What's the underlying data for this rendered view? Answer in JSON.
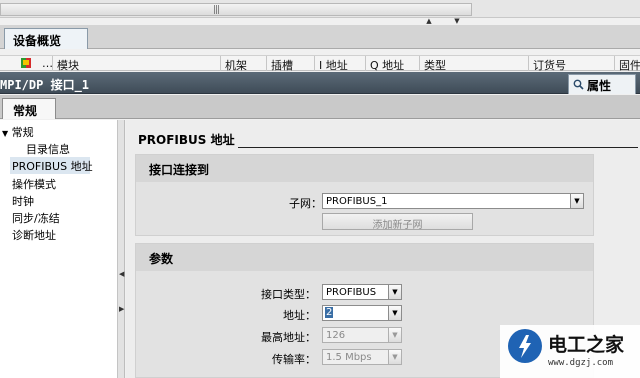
{
  "toolbar": {
    "scroll_grip": "|||"
  },
  "device_tabs": {
    "overview_tab": "设备概览"
  },
  "overview_columns": [
    "模块",
    "机架",
    "插槽",
    "I 地址",
    "Q 地址",
    "类型",
    "订货号",
    "固件"
  ],
  "window": {
    "title": "MPI/DP 接口_1",
    "properties_tab": "属性"
  },
  "general_tabs": {
    "general_tab": "常规"
  },
  "nav": {
    "items": [
      "常规",
      "目录信息",
      "PROFIBUS 地址",
      "操作模式",
      "时钟",
      "同步/冻结",
      "诊断地址"
    ],
    "selected": "PROFIBUS 地址"
  },
  "section": {
    "title": "PROFIBUS 地址"
  },
  "interface_panel": {
    "title": "接口连接到",
    "subnet_label": "子网：",
    "subnet_value": "PROFIBUS_1",
    "add_subnet_button": "添加新子网"
  },
  "params_panel": {
    "title": "参数",
    "interface_type_label": "接口类型：",
    "interface_type_value": "PROFIBUS",
    "address_label": "地址：",
    "address_value": "2",
    "highest_address_label": "最高地址：",
    "highest_address_value": "126",
    "baud_rate_label": "传输率：",
    "baud_rate_value": "1.5 Mbps"
  },
  "watermark": {
    "brand": "电工之家",
    "url": "www.dgzj.com"
  },
  "colors": {
    "title_bar": "#4b5966",
    "selection_blue": "#3a6ea5",
    "logo_blue": "#1f63b4"
  }
}
